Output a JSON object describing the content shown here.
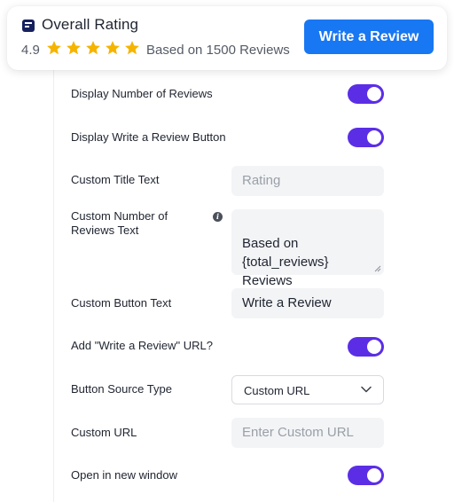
{
  "header": {
    "title": "Overall Rating",
    "rating_value": "4.9",
    "star_count": 5,
    "reviews_text": "Based on 1500 Reviews",
    "button_label": "Write a Review"
  },
  "settings": {
    "display_number_of_reviews": {
      "label": "Display Number of Reviews",
      "enabled": true
    },
    "display_write_review_button": {
      "label": "Display Write a Review Button",
      "enabled": true
    },
    "custom_title_text": {
      "label": "Custom Title Text",
      "placeholder": "Rating",
      "value": ""
    },
    "custom_number_of_reviews_text": {
      "label": "Custom Number of\nReviews Text",
      "value": "Based on\n{total_reviews}\nReviews"
    },
    "custom_button_text": {
      "label": "Custom Button Text",
      "value": "Write a Review"
    },
    "add_write_review_url": {
      "label": "Add \"Write a Review\" URL?",
      "enabled": true
    },
    "button_source_type": {
      "label": "Button Source Type",
      "selected": "Custom URL"
    },
    "custom_url": {
      "label": "Custom URL",
      "placeholder": "Enter Custom URL",
      "value": ""
    },
    "open_in_new_window": {
      "label": "Open in new window",
      "enabled": true
    }
  },
  "colors": {
    "accent_purple": "#5b2ee6",
    "button_blue": "#1877f2",
    "star_gold": "#f5b400",
    "logo_navy": "#17205e"
  },
  "icons": [
    "logo-icon",
    "star-icon",
    "info-icon",
    "resize-icon",
    "chevron-down-icon"
  ]
}
